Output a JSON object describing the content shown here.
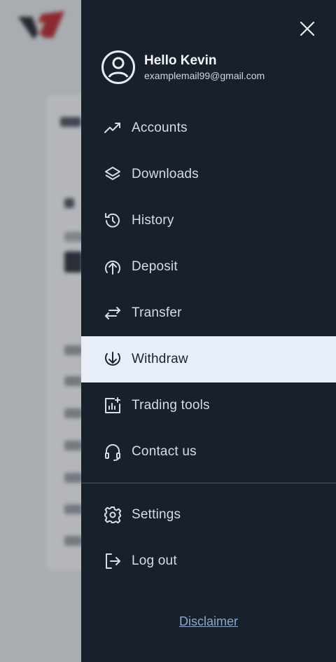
{
  "drawer": {
    "user": {
      "greeting": "Hello Kevin",
      "email": "examplemail99@gmail.com"
    },
    "menu": [
      {
        "label": "Accounts",
        "icon": "trending-up-icon"
      },
      {
        "label": "Downloads",
        "icon": "layers-icon"
      },
      {
        "label": "History",
        "icon": "history-icon"
      },
      {
        "label": "Deposit",
        "icon": "upload-circle-icon"
      },
      {
        "label": "Transfer",
        "icon": "transfer-arrows-icon"
      },
      {
        "label": "Withdraw",
        "icon": "download-circle-icon",
        "active": true
      },
      {
        "label": "Trading tools",
        "icon": "chart-plus-icon"
      },
      {
        "label": "Contact us",
        "icon": "headset-icon"
      }
    ],
    "secondary_menu": [
      {
        "label": "Settings",
        "icon": "gear-icon"
      },
      {
        "label": "Log out",
        "icon": "logout-icon"
      }
    ],
    "disclaimer_label": "Disclaimer"
  },
  "colors": {
    "drawer_bg": "#18212b",
    "active_bg": "#e8eef8",
    "link": "#8ea7c9"
  }
}
